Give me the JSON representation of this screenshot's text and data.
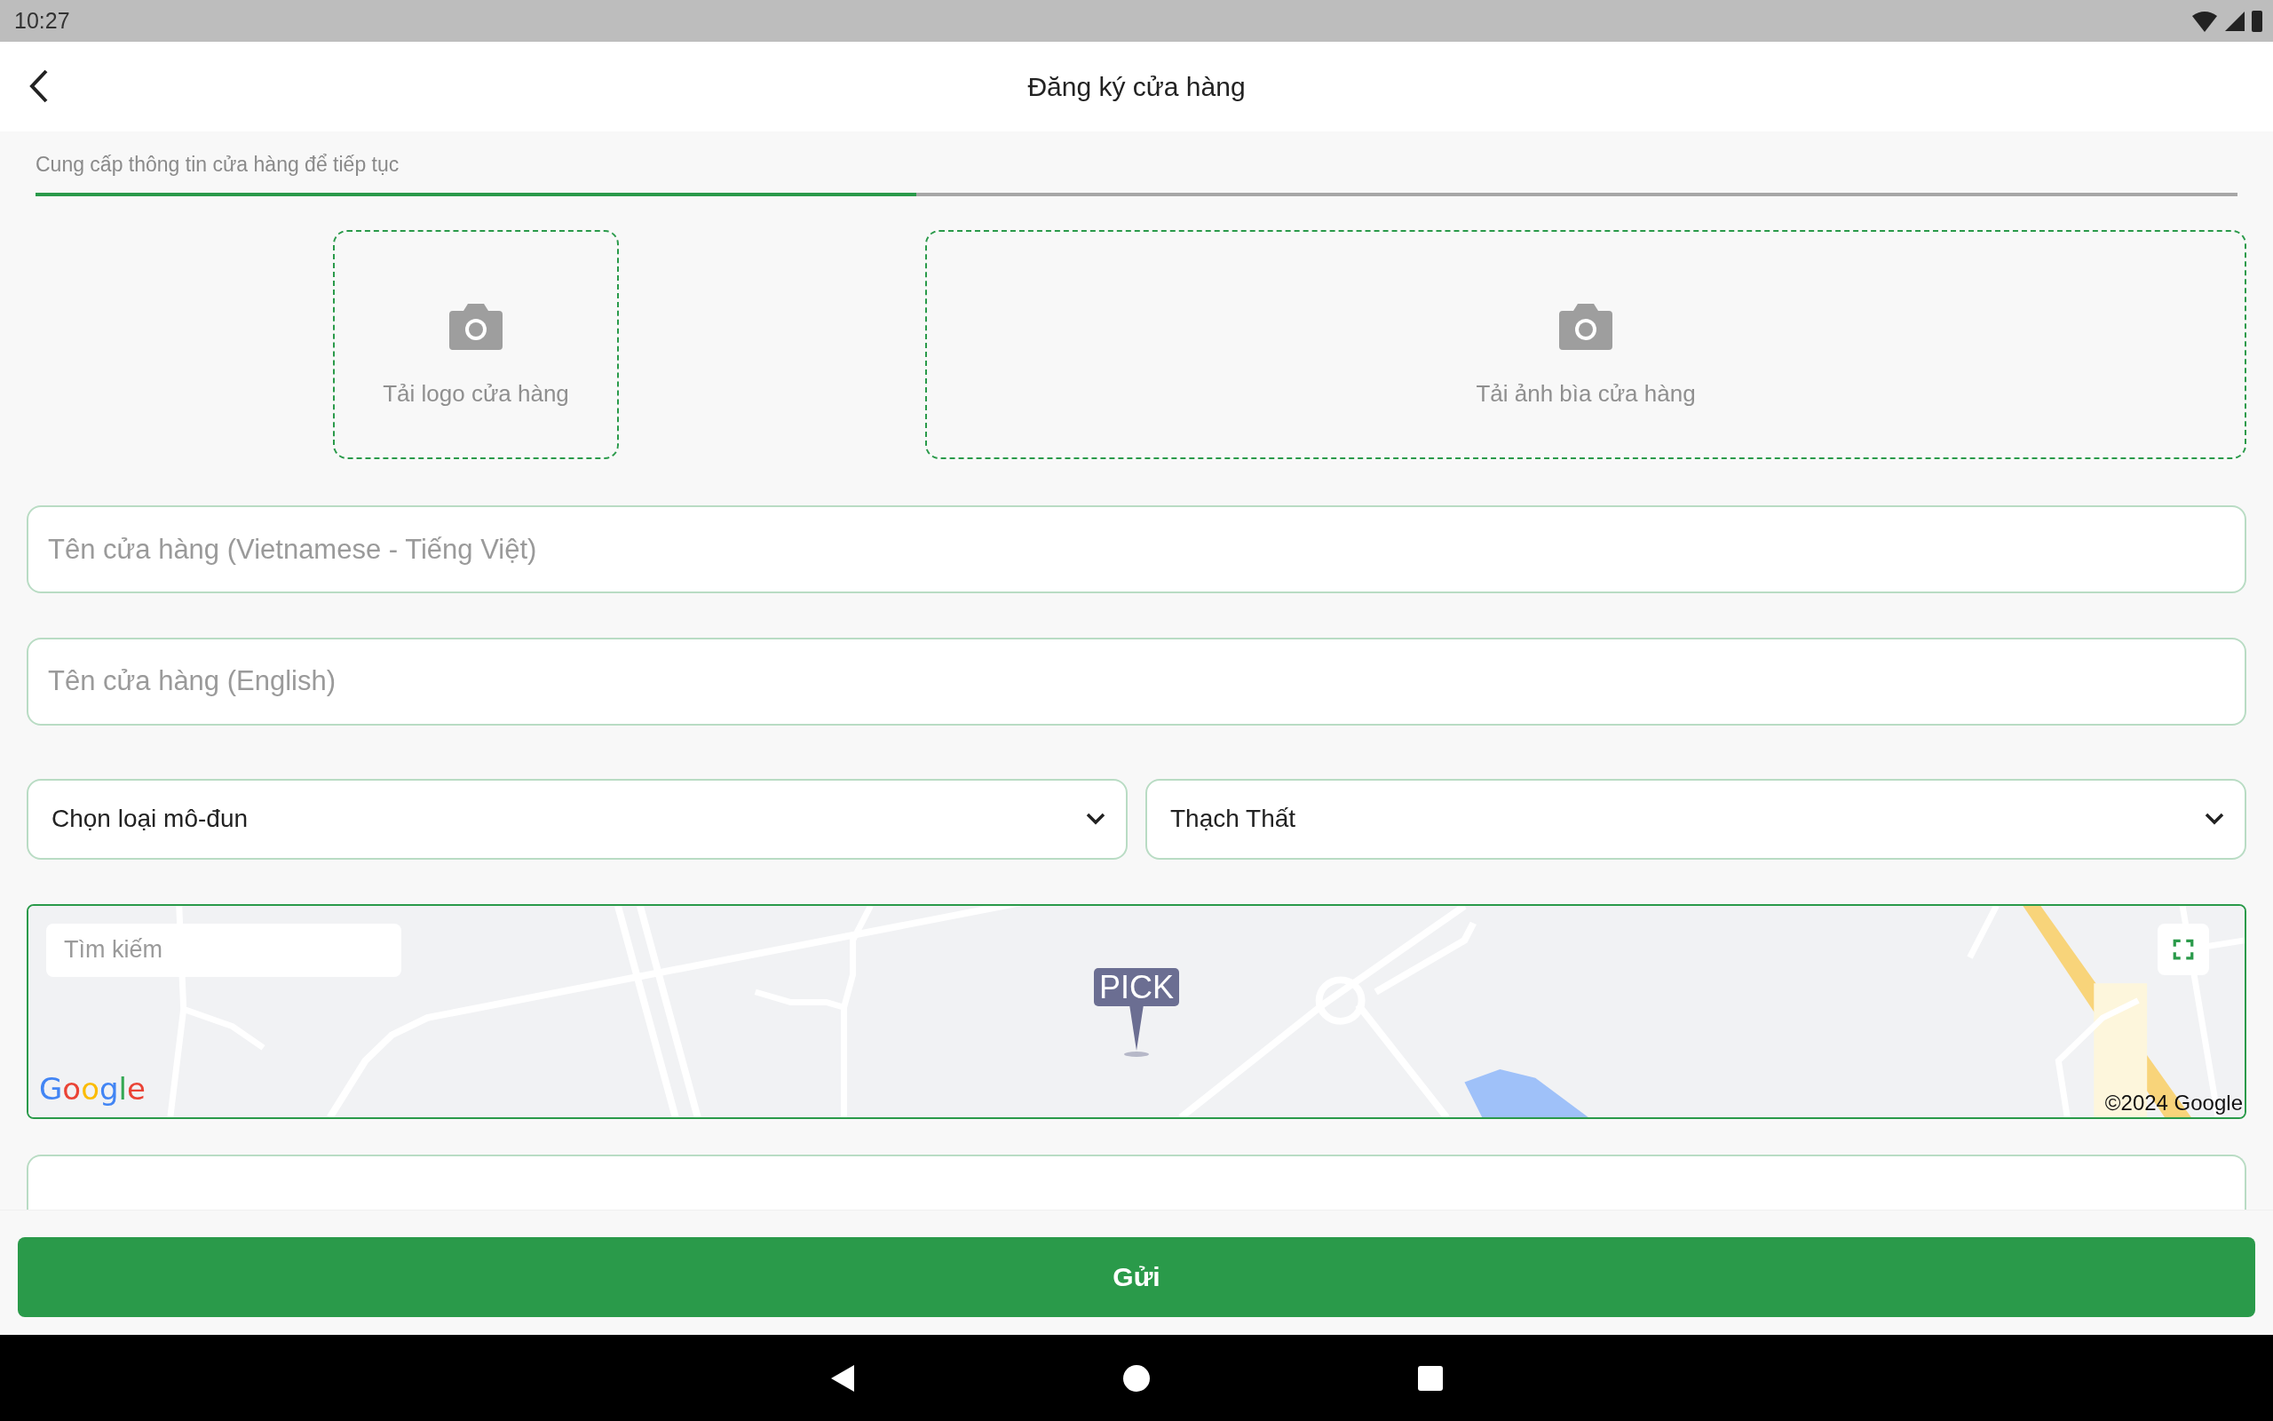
{
  "status_bar": {
    "time": "10:27"
  },
  "app_bar": {
    "title": "Đăng ký cửa hàng"
  },
  "progress": {
    "caption": "Cung cấp thông tin cửa hàng để tiếp tục",
    "level": 0.4
  },
  "uploads": [
    {
      "kind": "logo",
      "label": "Tải logo cửa hàng"
    },
    {
      "kind": "cover",
      "label": "Tải ảnh bìa cửa hàng"
    }
  ],
  "fields": [
    {
      "placeholder": "Tên cửa hàng (Vietnamese - Tiếng Việt)"
    },
    {
      "placeholder": "Tên cửa hàng (English)"
    }
  ],
  "dropdowns": [
    {
      "value": "Chọn loại mô-đun"
    },
    {
      "value": "Thạch Thất"
    }
  ],
  "map": {
    "search_placeholder": "Tìm kiếm",
    "marker": "PICK",
    "logo": "Google",
    "copyright": "©2024 Google"
  },
  "submit_button": "Gửi"
}
